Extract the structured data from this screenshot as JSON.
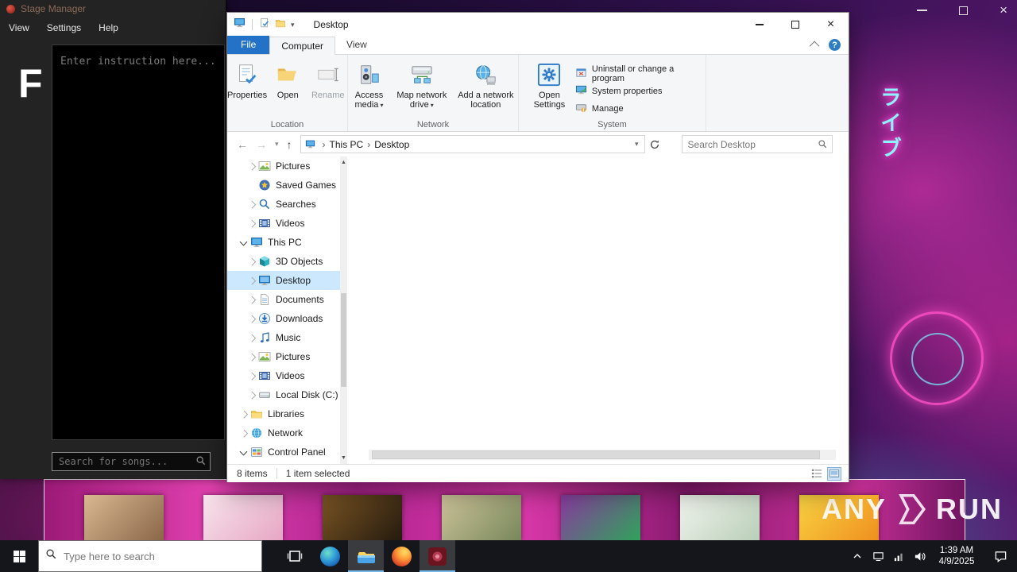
{
  "colors": {
    "accent_tab_blue": "#2472c8",
    "nav_selection_blue": "#cce8ff",
    "strip_pink": "#c42a96",
    "taskbar_black": "#14161b"
  },
  "wallpaper": {
    "vertical_neon_text": "ライブ"
  },
  "anyrun": {
    "watermark_left": "ANY",
    "watermark_right": "RUN"
  },
  "stage_manager": {
    "title": "Stage Manager",
    "menu": {
      "view": "View",
      "settings": "Settings",
      "help": "Help"
    },
    "logo_letter": "F",
    "instruction_placeholder": "Enter instruction here...",
    "song_search_placeholder": "Search for songs..."
  },
  "explorer": {
    "window_title": "Desktop",
    "tabs": {
      "file": "File",
      "computer": "Computer",
      "view": "View"
    },
    "ribbon": {
      "location_group": {
        "label": "Location",
        "properties": "Properties",
        "open": "Open",
        "rename": "Rename"
      },
      "network_group": {
        "label": "Network",
        "access_media": "Access media",
        "map_network_drive": "Map network drive",
        "add_network_location": "Add a network location"
      },
      "system_group": {
        "label": "System",
        "open_settings": "Open Settings",
        "uninstall": "Uninstall or change a program",
        "system_properties": "System properties",
        "manage": "Manage"
      }
    },
    "address_bar": {
      "crumb_root": "This PC",
      "crumb_current": "Desktop",
      "search_placeholder": "Search Desktop"
    },
    "nav_items": [
      {
        "label": "Pictures",
        "icon": "pictures",
        "chevron": "right",
        "indent": 1,
        "selected": false
      },
      {
        "label": "Saved Games",
        "icon": "saved-games",
        "chevron": "none",
        "indent": 1,
        "selected": false
      },
      {
        "label": "Searches",
        "icon": "searches",
        "chevron": "right",
        "indent": 1,
        "selected": false
      },
      {
        "label": "Videos",
        "icon": "videos",
        "chevron": "right",
        "indent": 1,
        "selected": false
      },
      {
        "label": "This PC",
        "icon": "this-pc",
        "chevron": "down",
        "indent": 0,
        "selected": false
      },
      {
        "label": "3D Objects",
        "icon": "3d-objects",
        "chevron": "right",
        "indent": 1,
        "selected": false
      },
      {
        "label": "Desktop",
        "icon": "desktop",
        "chevron": "right",
        "indent": 1,
        "selected": true
      },
      {
        "label": "Documents",
        "icon": "documents",
        "chevron": "right",
        "indent": 1,
        "selected": false
      },
      {
        "label": "Downloads",
        "icon": "downloads",
        "chevron": "right",
        "indent": 1,
        "selected": false
      },
      {
        "label": "Music",
        "icon": "music",
        "chevron": "right",
        "indent": 1,
        "selected": false
      },
      {
        "label": "Pictures",
        "icon": "pictures",
        "chevron": "right",
        "indent": 1,
        "selected": false
      },
      {
        "label": "Videos",
        "icon": "videos",
        "chevron": "right",
        "indent": 1,
        "selected": false
      },
      {
        "label": "Local Disk (C:)",
        "icon": "local-disk",
        "chevron": "right",
        "indent": 1,
        "selected": false
      },
      {
        "label": "Libraries",
        "icon": "libraries",
        "chevron": "right",
        "indent": 0,
        "selected": false
      },
      {
        "label": "Network",
        "icon": "network",
        "chevron": "right",
        "indent": 0,
        "selected": false
      },
      {
        "label": "Control Panel",
        "icon": "control-panel",
        "chevron": "down",
        "indent": 0,
        "selected": false
      }
    ],
    "status_bar": {
      "item_count": "8 items",
      "selection": "1 item selected"
    }
  },
  "album_strip": [
    {
      "name": "album-1",
      "c1": "#d9b891",
      "c2": "#8a6648"
    },
    {
      "name": "album-2",
      "c1": "#f7e4ec",
      "c2": "#e7a6c4"
    },
    {
      "name": "album-3",
      "c1": "#7a5524",
      "c2": "#241a0e"
    },
    {
      "name": "album-4",
      "c1": "#cfc49b",
      "c2": "#76875a"
    },
    {
      "name": "album-5",
      "c1": "#8a3aa0",
      "c2": "#2fa35a"
    },
    {
      "name": "album-6",
      "c1": "#f1f5ee",
      "c2": "#b9ceb8"
    },
    {
      "name": "album-7",
      "c1": "#f9d342",
      "c2": "#ef8f1f"
    }
  ],
  "taskbar": {
    "search_placeholder": "Type here to search",
    "apps": [
      {
        "name": "task-view",
        "active": false
      },
      {
        "name": "edge",
        "active": false
      },
      {
        "name": "file-explorer",
        "active": true
      },
      {
        "name": "firefox",
        "active": false
      },
      {
        "name": "stage-manager-app",
        "active": true
      }
    ],
    "clock": {
      "time": "1:39 AM",
      "date": "4/9/2025"
    }
  }
}
